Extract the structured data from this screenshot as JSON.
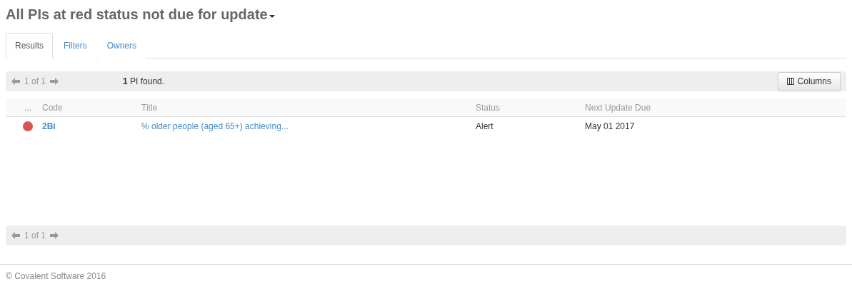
{
  "title": "All PIs at red status not due for update",
  "tabs": [
    {
      "label": "Results",
      "selected": true
    },
    {
      "label": "Filters",
      "selected": false
    },
    {
      "label": "Owners",
      "selected": false
    }
  ],
  "top_pager": {
    "page": "1 of 1",
    "summary": "**1** PI found.",
    "columns_button": "Columns"
  },
  "table": {
    "columns": [
      "...",
      "Code",
      "Title",
      "Status",
      "Next Update Due"
    ],
    "rows": [
      {
        "color": "#d9534f",
        "code": "2Bi",
        "title": "% older people (aged 65+) achieving...",
        "status": "Alert",
        "next_update_due": "May 01 2017"
      }
    ]
  },
  "bottom_pager": {
    "page": "1 of 1"
  },
  "footer": "© Covalent Software 2016"
}
